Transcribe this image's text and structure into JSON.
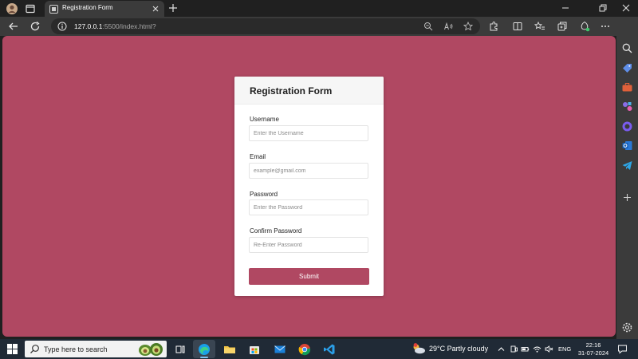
{
  "browser": {
    "tab_title": "Registration Form",
    "url_host": "127.0.0.1",
    "url_path": ":5500/index.html?"
  },
  "form": {
    "title": "Registration Form",
    "fields": [
      {
        "label": "Username",
        "placeholder": "Enter the Username"
      },
      {
        "label": "Email",
        "placeholder": "example@gmail.com"
      },
      {
        "label": "Password",
        "placeholder": "Enter the Password"
      },
      {
        "label": "Confirm Password",
        "placeholder": "Re-Enter Password"
      }
    ],
    "submit_label": "Submit"
  },
  "taskbar": {
    "search_placeholder": "Type here to search",
    "weather": "29°C  Partly cloudy",
    "weather_badge": "1",
    "language": "ENG",
    "time": "22:16",
    "date": "31-07-2024"
  },
  "colors": {
    "page_background": "#b04862",
    "button": "#b04862",
    "browser_chrome": "#202020",
    "taskbar": "#202a36"
  }
}
